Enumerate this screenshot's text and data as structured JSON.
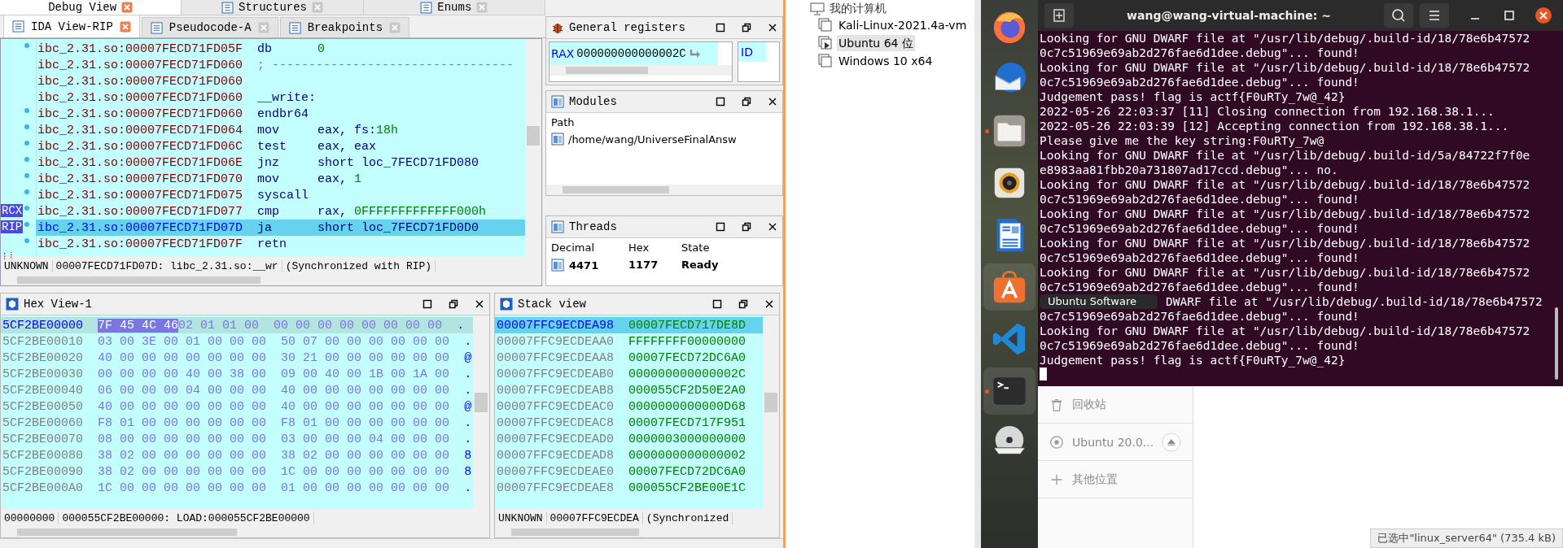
{
  "ida": {
    "top_tabs": [
      {
        "label": "Debug View",
        "selected": true
      },
      {
        "label": "Structures",
        "selected": false
      },
      {
        "label": "Enums",
        "selected": false
      }
    ],
    "view_tabs": [
      {
        "label": "IDA View-RIP",
        "selected": true
      },
      {
        "label": "Pseudocode-A",
        "selected": false
      },
      {
        "label": "Breakpoints",
        "selected": false
      }
    ],
    "disassembly": {
      "rows": [
        {
          "kind": "instruction",
          "address": "ibc_2.31.so:00007FECD71FD05F",
          "mnemonic": "db",
          "operands": "",
          "immediate": "0",
          "marker": true,
          "current": false
        },
        {
          "kind": "comment",
          "address": "ibc_2.31.so:00007FECD71FD060",
          "text": "; ---------------------------------",
          "marker": false,
          "current": false
        },
        {
          "kind": "blank",
          "address": "ibc_2.31.so:00007FECD71FD060",
          "marker": false,
          "current": false
        },
        {
          "kind": "label",
          "address": "ibc_2.31.so:00007FECD71FD060",
          "text": "__write:",
          "marker": false,
          "current": false
        },
        {
          "kind": "instruction",
          "address": "ibc_2.31.so:00007FECD71FD060",
          "mnemonic": "endbr64",
          "operands": "",
          "marker": true,
          "current": false
        },
        {
          "kind": "instruction",
          "address": "ibc_2.31.so:00007FECD71FD064",
          "mnemonic": "mov",
          "operands": "eax, fs:",
          "immediate": "18h",
          "marker": true,
          "current": false
        },
        {
          "kind": "instruction",
          "address": "ibc_2.31.so:00007FECD71FD06C",
          "mnemonic": "test",
          "operands": "eax, eax",
          "marker": true,
          "current": false
        },
        {
          "kind": "instruction",
          "address": "ibc_2.31.so:00007FECD71FD06E",
          "mnemonic": "jnz",
          "operands": "short loc_7FECD71FD080",
          "marker": true,
          "current": false
        },
        {
          "kind": "instruction",
          "address": "ibc_2.31.so:00007FECD71FD070",
          "mnemonic": "mov",
          "operands": "eax, ",
          "immediate": "1",
          "marker": true,
          "current": false
        },
        {
          "kind": "instruction",
          "address": "ibc_2.31.so:00007FECD71FD075",
          "mnemonic": "syscall",
          "operands": "",
          "marker": true,
          "current": false
        },
        {
          "kind": "instruction",
          "address": "ibc_2.31.so:00007FECD71FD077",
          "mnemonic": "cmp",
          "operands": "rax, ",
          "immediate": "0FFFFFFFFFFFFF000h",
          "register": "RCX",
          "marker": true,
          "current": false
        },
        {
          "kind": "instruction",
          "address": "ibc_2.31.so:00007FECD71FD07D",
          "mnemonic": "ja",
          "operands": "short loc_7FECD71FD0D0",
          "register": "RIP",
          "marker": true,
          "current": true
        },
        {
          "kind": "instruction",
          "address": "ibc_2.31.so:00007FECD71FD07F",
          "mnemonic": "retn",
          "operands": "",
          "marker": true,
          "current": false
        }
      ],
      "status": [
        "UNKNOWN",
        "00007FECD71FD07D: libc_2.31.so:__wr",
        "(Synchronized with RIP)"
      ]
    },
    "registers": {
      "title": "General registers",
      "name": "RAX",
      "value": "000000000000002C",
      "flags_label": "ID"
    },
    "modules": {
      "title": "Modules",
      "column": "Path",
      "rows": [
        "/home/wang/UniverseFinalAnsw"
      ]
    },
    "threads": {
      "title": "Threads",
      "columns": [
        "Decimal",
        "Hex",
        "State"
      ],
      "rows": [
        {
          "decimal": "4471",
          "hex": "1177",
          "state": "Ready"
        }
      ]
    },
    "hex_view": {
      "title": "Hex View-1",
      "rows": [
        {
          "address": "5CF2BE00000",
          "selected": true,
          "selected_prefix": "7F 45 4C 46",
          "bytes_left": "02 01 01 00",
          "bytes_right": "00 00 00 00 00 00 00 00",
          "ascii": "."
        },
        {
          "address": "5CF2BE00010",
          "selected": false,
          "bytes_left": "03 00 3E 00 01 00 00 00",
          "bytes_right": "50 07 00 00 00 00 00 00",
          "ascii": "."
        },
        {
          "address": "5CF2BE00020",
          "selected": false,
          "bytes_left": "40 00 00 00 00 00 00 00",
          "bytes_right": "30 21 00 00 00 00 00 00",
          "ascii": "@"
        },
        {
          "address": "5CF2BE00030",
          "selected": false,
          "bytes_left": "00 00 00 00 40 00 38 00",
          "bytes_right": "09 00 40 00 1B 00 1A 00",
          "ascii": "."
        },
        {
          "address": "5CF2BE00040",
          "selected": false,
          "bytes_left": "06 00 00 00 04 00 00 00",
          "bytes_right": "40 00 00 00 00 00 00 00",
          "ascii": "."
        },
        {
          "address": "5CF2BE00050",
          "selected": false,
          "bytes_left": "40 00 00 00 00 00 00 00",
          "bytes_right": "40 00 00 00 00 00 00 00",
          "ascii": "@"
        },
        {
          "address": "5CF2BE00060",
          "selected": false,
          "bytes_left": "F8 01 00 00 00 00 00 00",
          "bytes_right": "F8 01 00 00 00 00 00 00",
          "ascii": "."
        },
        {
          "address": "5CF2BE00070",
          "selected": false,
          "bytes_left": "08 00 00 00 00 00 00 00",
          "bytes_right": "03 00 00 00 04 00 00 00",
          "ascii": "."
        },
        {
          "address": "5CF2BE00080",
          "selected": false,
          "bytes_left": "38 02 00 00 00 00 00 00",
          "bytes_right": "38 02 00 00 00 00 00 00",
          "ascii": "8"
        },
        {
          "address": "5CF2BE00090",
          "selected": false,
          "bytes_left": "38 02 00 00 00 00 00 00",
          "bytes_right": "1C 00 00 00 00 00 00 00",
          "ascii": "8"
        },
        {
          "address": "5CF2BE000A0",
          "selected": false,
          "bytes_left": "1C 00 00 00 00 00 00 00",
          "bytes_right": "01 00 00 00 00 00 00 00",
          "ascii": "."
        }
      ],
      "status": [
        "00000000",
        "000055CF2BE00000: LOAD:000055CF2BE00000"
      ]
    },
    "stack_view": {
      "title": "Stack view",
      "rows": [
        {
          "address": "00007FFC9ECDEA98",
          "value": "00007FECD717DE8D",
          "selected": true
        },
        {
          "address": "00007FFC9ECDEAA0",
          "value": "FFFFFFFF00000000",
          "selected": false
        },
        {
          "address": "00007FFC9ECDEAA8",
          "value": "00007FECD72DC6A0",
          "selected": false
        },
        {
          "address": "00007FFC9ECDEAB0",
          "value": "000000000000002C",
          "selected": false
        },
        {
          "address": "00007FFC9ECDEAB8",
          "value": "000055CF2D50E2A0",
          "selected": false
        },
        {
          "address": "00007FFC9ECDEAC0",
          "value": "0000000000000D68",
          "selected": false
        },
        {
          "address": "00007FFC9ECDEAC8",
          "value": "00007FECD717F951",
          "selected": false
        },
        {
          "address": "00007FFC9ECDEAD0",
          "value": "0000003000000000",
          "selected": false
        },
        {
          "address": "00007FFC9ECDEAD8",
          "value": "0000000000000002",
          "selected": false
        },
        {
          "address": "00007FFC9ECDEAE0",
          "value": "00007FECD72DC6A0",
          "selected": false
        },
        {
          "address": "00007FFC9ECDEAE8",
          "value": "000055CF2BE00E1C",
          "selected": false
        }
      ],
      "status": [
        "UNKNOWN",
        "00007FFC9ECDEA",
        "(Synchronized"
      ]
    }
  },
  "vm_library": {
    "root": "我的计算机",
    "items": [
      {
        "label": "Kali-Linux-2021.4a-vm",
        "running": false,
        "selected": false
      },
      {
        "label": "Ubuntu 64 位",
        "running": true,
        "selected": true
      },
      {
        "label": "Windows 10 x64",
        "running": false,
        "selected": false
      }
    ]
  },
  "dock": {
    "items": [
      {
        "kind": "browser",
        "running": false,
        "highlighted": false
      },
      {
        "kind": "mail",
        "running": false,
        "highlighted": false
      },
      {
        "kind": "files",
        "running": true,
        "highlighted": false
      },
      {
        "kind": "music",
        "running": false,
        "highlighted": false
      },
      {
        "kind": "writer",
        "running": false,
        "highlighted": false
      },
      {
        "kind": "software",
        "running": false,
        "highlighted": true
      },
      {
        "kind": "code",
        "running": false,
        "highlighted": false
      },
      {
        "kind": "terminal",
        "running": true,
        "highlighted": true
      },
      {
        "kind": "dvd",
        "running": false,
        "highlighted": false
      }
    ],
    "tooltip": "Ubuntu Software"
  },
  "terminal": {
    "title": "wang@wang-virtual-machine: ~",
    "lines": [
      {
        "text": "Looking for GNU DWARF file at \"/usr/lib/debug/.build-id/18/78e6b47572",
        "covered": false
      },
      {
        "text": "0c7c51969e69ab2d276fae6d1dee.debug\"... found!",
        "covered": false
      },
      {
        "text": "Looking for GNU DWARF file at \"/usr/lib/debug/.build-id/18/78e6b47572",
        "covered": false
      },
      {
        "text": "0c7c51969e69ab2d276fae6d1dee.debug\"... found!",
        "covered": false
      },
      {
        "text": "Judgement pass! flag is actf{F0uRTy_7w@_42}",
        "covered": false
      },
      {
        "text": "2022-05-26 22:03:37 [11] Closing connection from 192.168.38.1...",
        "covered": false
      },
      {
        "text": "2022-05-26 22:03:39 [12] Accepting connection from 192.168.38.1...",
        "covered": false
      },
      {
        "text": "Please give me the key string:F0uRTy_7w@",
        "covered": false
      },
      {
        "text": "Looking for GNU DWARF file at \"/usr/lib/debug/.build-id/5a/84722f7f0e",
        "covered": false
      },
      {
        "text": "e8983aa81fbb20a731807ad17ccd.debug\"... no.",
        "covered": false
      },
      {
        "text": "Looking for GNU DWARF file at \"/usr/lib/debug/.build-id/18/78e6b47572",
        "covered": false
      },
      {
        "text": "0c7c51969e69ab2d276fae6d1dee.debug\"... found!",
        "covered": false
      },
      {
        "text": "Looking for GNU DWARF file at \"/usr/lib/debug/.build-id/18/78e6b47572",
        "covered": false
      },
      {
        "text": "0c7c51969e69ab2d276fae6d1dee.debug\"... found!",
        "covered": false
      },
      {
        "text": "Looking for GNU DWARF file at \"/usr/lib/debug/.build-id/18/78e6b47572",
        "covered": false
      },
      {
        "text": "0c7c51969e69ab2d276fae6d1dee.debug\"... found!",
        "covered": false
      },
      {
        "text": "Looking for GNU DWARF file at \"/usr/lib/debug/.build-id/18/78e6b47572",
        "covered": false
      },
      {
        "text": "0c7c51969e69ab2d276fae6d1dee.debug\"... found!",
        "covered": false
      },
      {
        "text": "DWARF file at \"/usr/lib/debug/.build-id/18/78e6b47572",
        "covered": true
      },
      {
        "text": "0c7c51969e69ab2d276fae6d1dee.debug\"... found!",
        "covered": false
      },
      {
        "text": "Looking for GNU DWARF file at \"/usr/lib/debug/.build-id/18/78e6b47572",
        "covered": false
      },
      {
        "text": "0c7c51969e69ab2d276fae6d1dee.debug\"... found!",
        "covered": false
      },
      {
        "text": "Judgement pass! flag is actf{F0uRTy_7w@_42}",
        "covered": false
      }
    ]
  },
  "files_sidebar": {
    "items": [
      {
        "kind": "trash",
        "label": "回收站"
      },
      {
        "kind": "drive",
        "label": "Ubuntu 20.0..."
      },
      {
        "kind": "other",
        "label": "其他位置"
      }
    ]
  },
  "status_bar": "已选中\"linux_server64\" (735.4 kB)"
}
